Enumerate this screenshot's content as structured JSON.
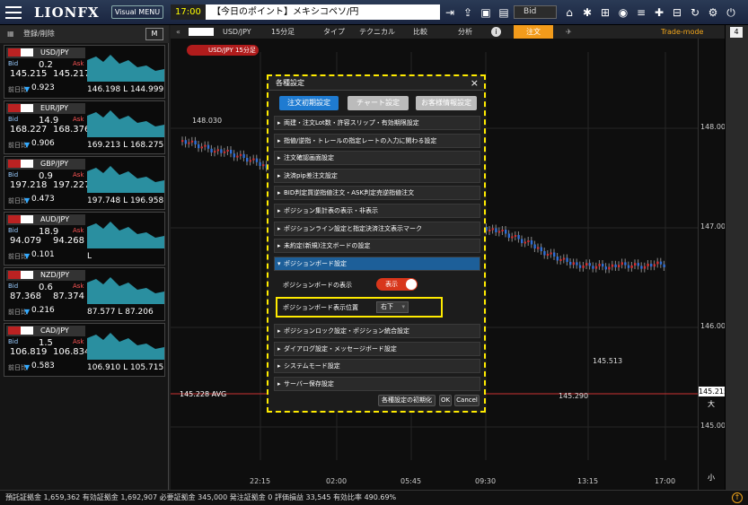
{
  "app": {
    "logo": "LIONFX",
    "visual_menu": "Visual MENU"
  },
  "ticker": {
    "time": "17:00",
    "text": "【今日のポイント】メキシコペソ/円"
  },
  "rate_select": "Bid",
  "left": {
    "header": "登録/削除",
    "m_button": "M",
    "pairs": [
      {
        "symbol": "USD/JPY",
        "spread": "0.2",
        "bid": "145.215",
        "ask": "145.217",
        "prev_label": "前日比",
        "change": "0.923",
        "hl": "146.198 L 144.999",
        "bid_label": "Bid",
        "ask_label": "Ask"
      },
      {
        "symbol": "EUR/JPY",
        "spread": "14.9",
        "bid": "168.227",
        "ask": "168.376",
        "prev_label": "前日比",
        "change": "0.906",
        "hl": "169.213 L 168.275",
        "bid_label": "Bid",
        "ask_label": "Ask"
      },
      {
        "symbol": "GBP/JPY",
        "spread": "0.9",
        "bid": "197.218",
        "ask": "197.227",
        "prev_label": "前日比",
        "change": "0.473",
        "hl": "197.748 L 196.958",
        "bid_label": "Bid",
        "ask_label": "Ask"
      },
      {
        "symbol": "AUD/JPY",
        "spread": "18.9",
        "bid": "94.079",
        "ask": "94.268",
        "prev_label": "前日比",
        "change": "0.101",
        "hl": "L",
        "bid_label": "Bid",
        "ask_label": "Ask"
      },
      {
        "symbol": "NZD/JPY",
        "spread": "0.6",
        "bid": "87.368",
        "ask": "87.374",
        "prev_label": "前日比",
        "change": "0.216",
        "hl": "87.577 L 87.206",
        "bid_label": "Bid",
        "ask_label": "Ask"
      },
      {
        "symbol": "CAD/JPY",
        "spread": "1.5",
        "bid": "106.819",
        "ask": "106.834",
        "prev_label": "前日比",
        "change": "0.583",
        "hl": "106.910 L 105.715",
        "bid_label": "Bid",
        "ask_label": "Ask"
      }
    ]
  },
  "chart": {
    "symbol": "USD/JPY",
    "timeframe": "15分足",
    "type_label": "タイプ",
    "technical_label": "テクニカル",
    "compare_label": "比較",
    "analysis_label": "分析",
    "order_label": "注文",
    "mode": "Trade-mode",
    "tag": "USD/JPY 15分足",
    "avg_label": "145.228 AVG",
    "current_price": "145.215",
    "price_labels": [
      "148.000",
      "147.000",
      "146.000",
      "145.000"
    ],
    "annotations": [
      "148.030",
      "145.513",
      "145.290"
    ],
    "time_labels": [
      "22:15",
      "02:00",
      "05:45",
      "09:30",
      "13:15",
      "17:00"
    ],
    "zoom_labels": [
      "大",
      "小"
    ]
  },
  "dialog": {
    "title": "各種設定",
    "close": "×",
    "tabs": [
      "注文初期設定",
      "チャート設定",
      "お客様情報設定"
    ],
    "sections": [
      "両建・注文Lot数・許容スリップ・有効期限設定",
      "指値/逆指・トレールの指定レートの入力に関わる設定",
      "注文確認画面設定",
      "決済pip差注文設定",
      "BID判定買逆指値注文・ASK判定売逆指値注文",
      "ポジション集計表の表示・非表示",
      "ポジションライン設定と指定決済注文表示マーク",
      "未約定(新規)注文ボードの設定"
    ],
    "open_section": "ポジションボード設定",
    "display_label": "ポジションボードの表示",
    "display_value": "表示",
    "position_label": "ポジションボード表示位置",
    "position_value": "右下",
    "sections_after": [
      "ポジションロック設定・ポジション統合設定",
      "ダイアログ設定・メッセージボード設定",
      "システムモード設定",
      "サーバー保存設定"
    ],
    "reset_label": "各種設定の初期化",
    "ok": "OK",
    "cancel": "Cancel"
  },
  "status": {
    "text": "預託証拠金 1,659,362 有効証拠金 1,692,907 必要証拠金 345,000 発注証拠金 0 評価損益 33,545 有効比率 490.69%"
  },
  "colors": {
    "accent_yellow": "#ffeb00",
    "tab_active": "#1f7bd1",
    "sparkline": "#2a8fa0",
    "candle_up": "#2f6fd6",
    "candle_down": "#d23030"
  }
}
